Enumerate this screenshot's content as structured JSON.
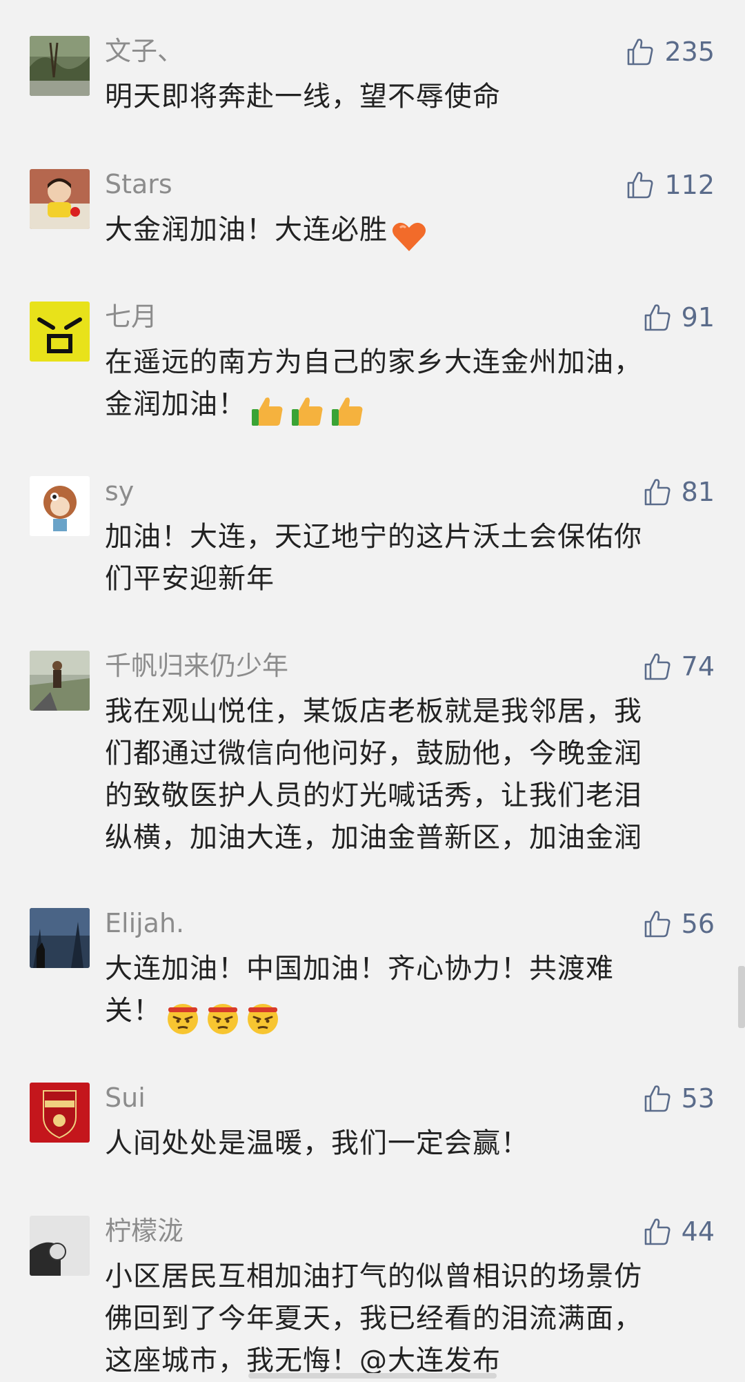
{
  "comments": [
    {
      "username": "文子、",
      "likes": "235",
      "lines": [
        "明天即将奔赴一线，望不辱使命"
      ],
      "emoji": ""
    },
    {
      "username": "Stars",
      "likes": "112",
      "lines": [
        "大金润加油！大连必胜"
      ],
      "emoji": "heart"
    },
    {
      "username": "七月",
      "likes": "91",
      "lines": [
        "在遥远的南方为自己的家乡大连金州加油，",
        "金润加油！"
      ],
      "emoji": "thumbs-up-x3"
    },
    {
      "username": "sy",
      "likes": "81",
      "lines": [
        "加油！大连，天辽地宁的这片沃土会保佑你",
        "们平安迎新年"
      ],
      "emoji": ""
    },
    {
      "username": "千帆归来仍少年",
      "likes": "74",
      "lines": [
        "我在观山悦住，某饭店老板就是我邻居，我",
        "们都通过微信向他问好，鼓励他，今晚金润",
        "的致敬医护人员的灯光喊话秀，让我们老泪",
        "纵横，加油大连，加油金普新区，加油金润"
      ],
      "emoji": ""
    },
    {
      "username": "Elijah.",
      "likes": "56",
      "lines": [
        "大连加油！中国加油！齐心协力！共渡难",
        "关！"
      ],
      "emoji": "determined-face-x3"
    },
    {
      "username": "Sui",
      "likes": "53",
      "lines": [
        "人间处处是温暖，我们一定会赢！"
      ],
      "emoji": ""
    },
    {
      "username": "柠檬泷",
      "likes": "44",
      "lines": [
        "小区居民互相加油打气的似曾相识的场景仿",
        "佛回到了今年夏天，我已经看的泪流满面，",
        "这座城市，我无悔！@大连发布"
      ],
      "emoji": ""
    }
  ],
  "colors": {
    "background": "#f2f2f2",
    "username": "#8c8c8c",
    "comment_text": "#222222",
    "like_accent": "#5a6b8a"
  },
  "icons": {
    "like": "thumbs-up-outline-icon"
  }
}
